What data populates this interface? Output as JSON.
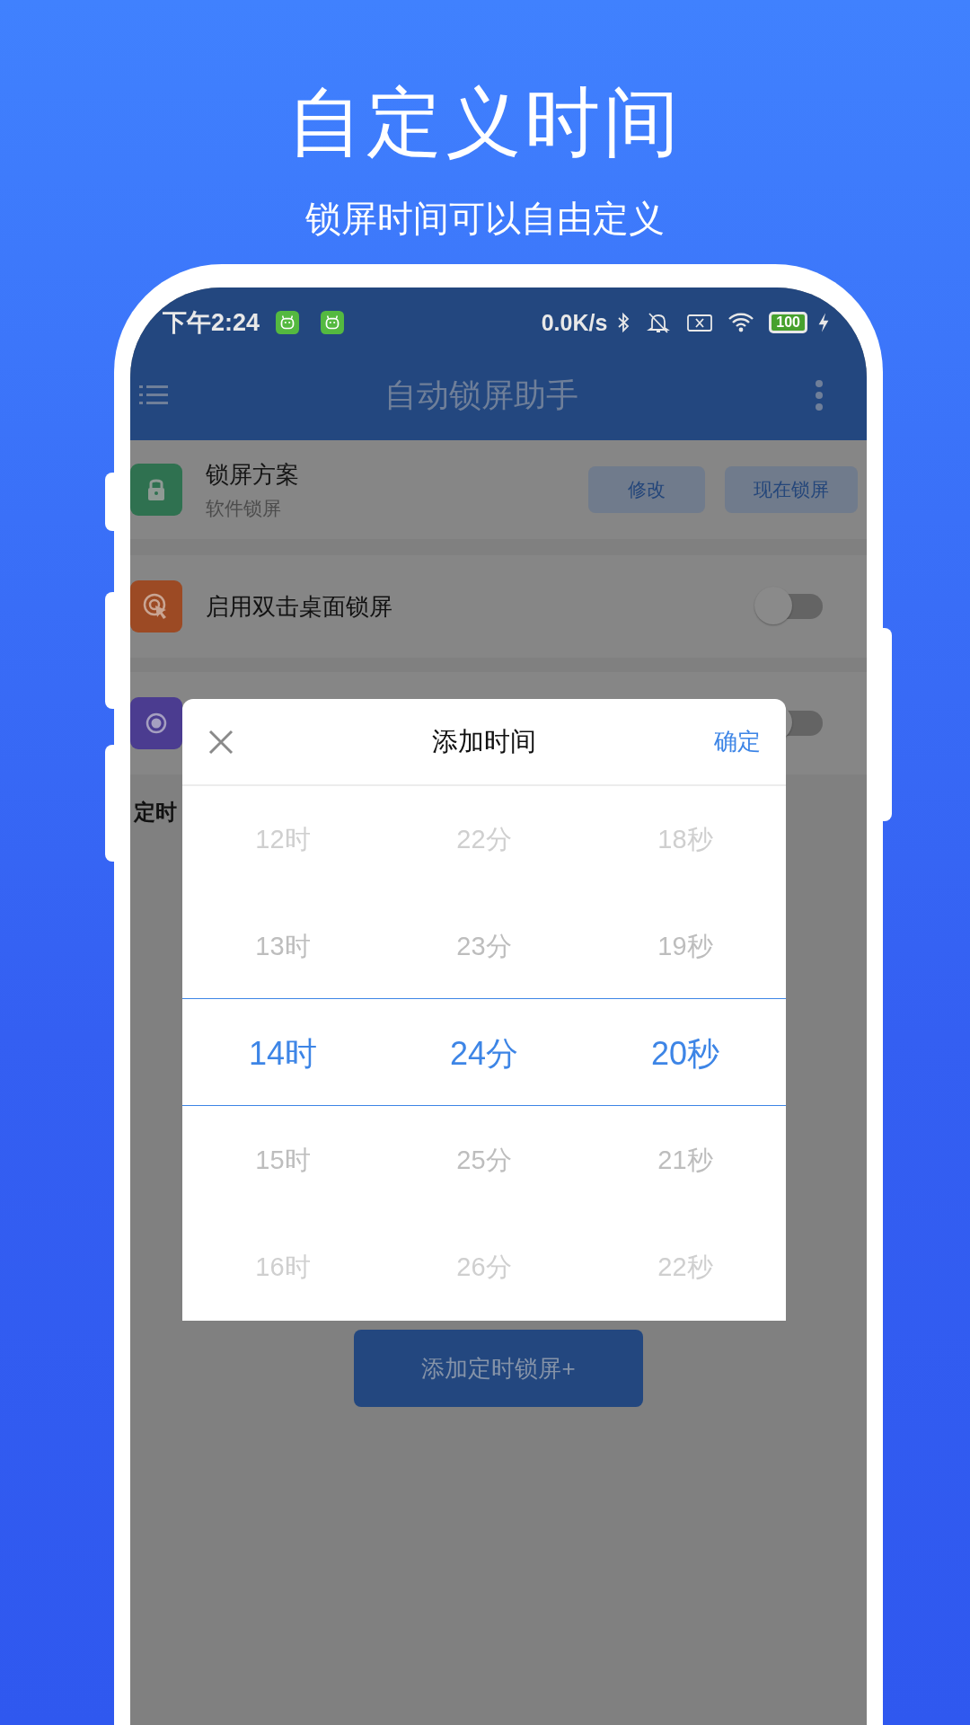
{
  "headline": {
    "title": "自定义时间",
    "subtitle": "锁屏时间可以自由定义"
  },
  "status_bar": {
    "time": "下午2:24",
    "network_speed": "0.0K/s",
    "battery": "100"
  },
  "toolbar": {
    "title": "自动锁屏助手"
  },
  "scheme_card": {
    "title": "锁屏方案",
    "subtitle": "软件锁屏",
    "buttons": [
      "修改",
      "现在锁屏"
    ]
  },
  "settings": [
    {
      "kind": "tap",
      "label": "启用双击桌面锁屏",
      "on": false,
      "color": "#9c4a24"
    },
    {
      "kind": "target",
      "on": false,
      "color": "#4b3c90"
    }
  ],
  "section_label": "定时",
  "dialog": {
    "title": "添加时间",
    "confirm": "确定",
    "columns": [
      {
        "items": [
          {
            "text": "12时",
            "selected": false
          },
          {
            "text": "13时",
            "selected": false
          },
          {
            "text": "14时",
            "selected": true
          },
          {
            "text": "15时",
            "selected": false
          },
          {
            "text": "16时",
            "selected": false
          }
        ]
      },
      {
        "items": [
          {
            "text": "22分",
            "selected": false
          },
          {
            "text": "23分",
            "selected": false
          },
          {
            "text": "24分",
            "selected": true
          },
          {
            "text": "25分",
            "selected": false
          },
          {
            "text": "26分",
            "selected": false
          }
        ]
      },
      {
        "items": [
          {
            "text": "18秒",
            "selected": false
          },
          {
            "text": "19秒",
            "selected": false
          },
          {
            "text": "20秒",
            "selected": true
          },
          {
            "text": "21秒",
            "selected": false
          },
          {
            "text": "22秒",
            "selected": false
          }
        ]
      }
    ]
  },
  "add_button": "添加定时锁屏+"
}
